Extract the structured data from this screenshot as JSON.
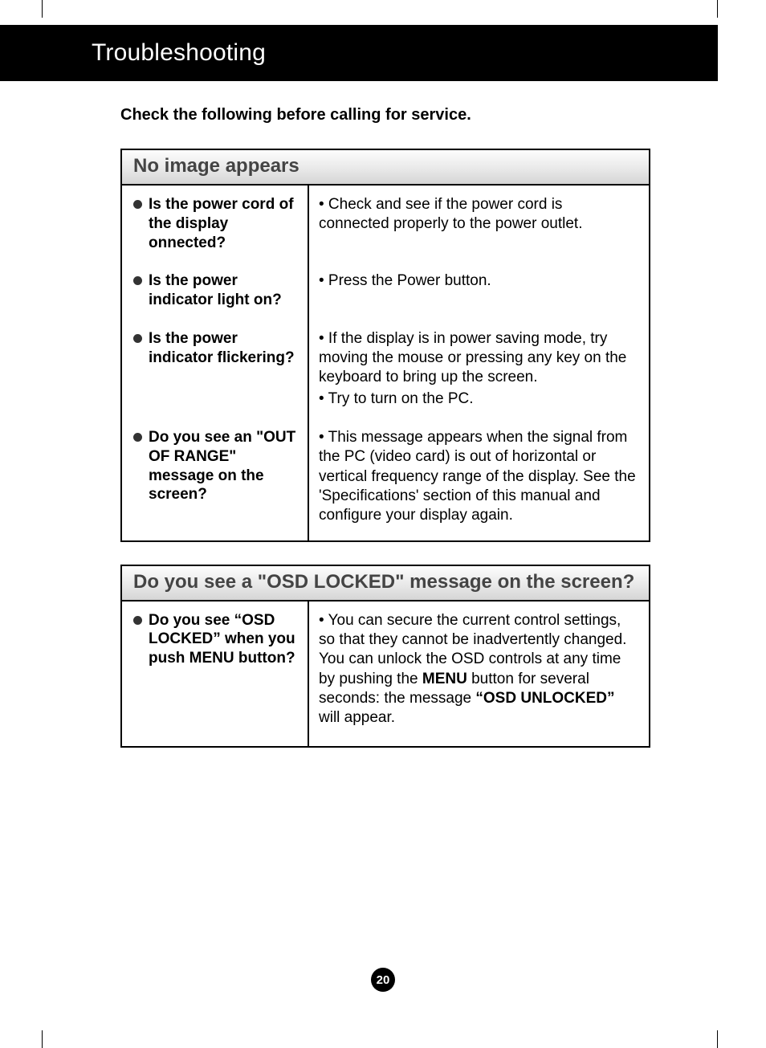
{
  "header": {
    "title": "Troubleshooting"
  },
  "intro": "Check the following before calling for service.",
  "section1": {
    "title": "No image appears",
    "rows": [
      {
        "q": "Is the power cord of the display onnected?",
        "a1": "• Check and see if the power cord is connected properly to the power outlet."
      },
      {
        "q": "Is the power indicator light on?",
        "a1": "• Press the Power button."
      },
      {
        "q": "Is the power indicator flickering?",
        "a1": "• If the display is in power saving mode, try moving the mouse or pressing any key on the keyboard to bring up the screen.",
        "a2": "• Try to turn on the PC."
      },
      {
        "q": "Do you see an \"OUT OF RANGE\" message on the screen?",
        "a1": "• This message appears when the signal from the PC (video card) is out of horizontal or vertical frequency range of the display. See the 'Specifications' section of this manual and configure your display again."
      }
    ]
  },
  "section2": {
    "title": "Do you see a \"OSD LOCKED\" message on the screen?",
    "rows": [
      {
        "q": "Do you see “OSD LOCKED” when you push MENU button?",
        "a_pre": "• You can secure the current control settings, so that they cannot be inadvertently changed. You can unlock the OSD controls at any time by pushing the ",
        "a_b1": "MENU",
        "a_mid": " button for several seconds: the message ",
        "a_b2": "“OSD UNLOCKED”",
        "a_post": " will appear."
      }
    ]
  },
  "page_number": "20"
}
